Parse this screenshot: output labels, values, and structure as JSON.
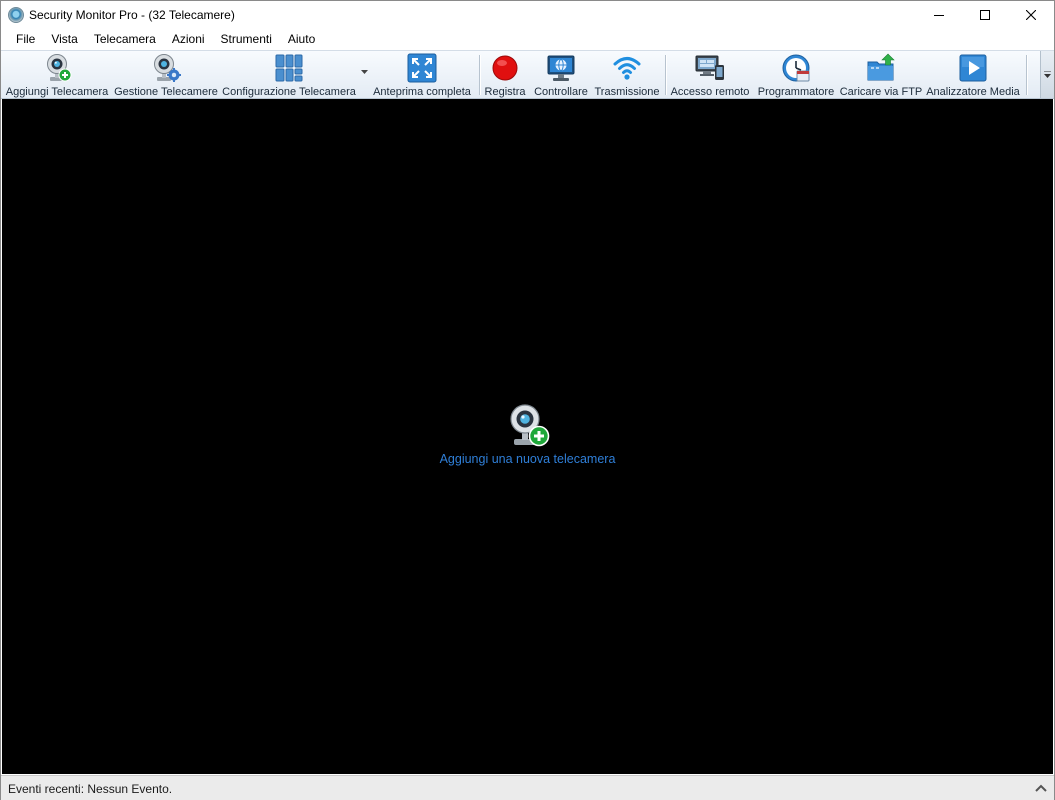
{
  "window": {
    "title": "Security Monitor Pro - (32 Telecamere)"
  },
  "menu": [
    "File",
    "Vista",
    "Telecamera",
    "Azioni",
    "Strumenti",
    "Aiuto"
  ],
  "toolbar": {
    "add_camera": "Aggiungi Telecamera",
    "manage_cameras": "Gestione Telecamere",
    "camera_config": "Configurazione Telecamera",
    "full_preview": "Anteprima completa",
    "record": "Registra",
    "monitor": "Controllare",
    "broadcast": "Trasmissione",
    "remote_access": "Accesso remoto",
    "scheduler": "Programmatore",
    "ftp_upload": "Caricare via FTP",
    "media_analyzer": "Analizzatore Media"
  },
  "main": {
    "add_new_camera_label": "Aggiungi una nuova telecamera"
  },
  "status": {
    "text": "Eventi recenti: Nessun Evento."
  },
  "colors": {
    "video_background": "#000000",
    "link": "#2f7fd8",
    "record": "#e01010",
    "toolbar_top": "#f8fbfe",
    "toolbar_bottom": "#e3ebf4"
  }
}
